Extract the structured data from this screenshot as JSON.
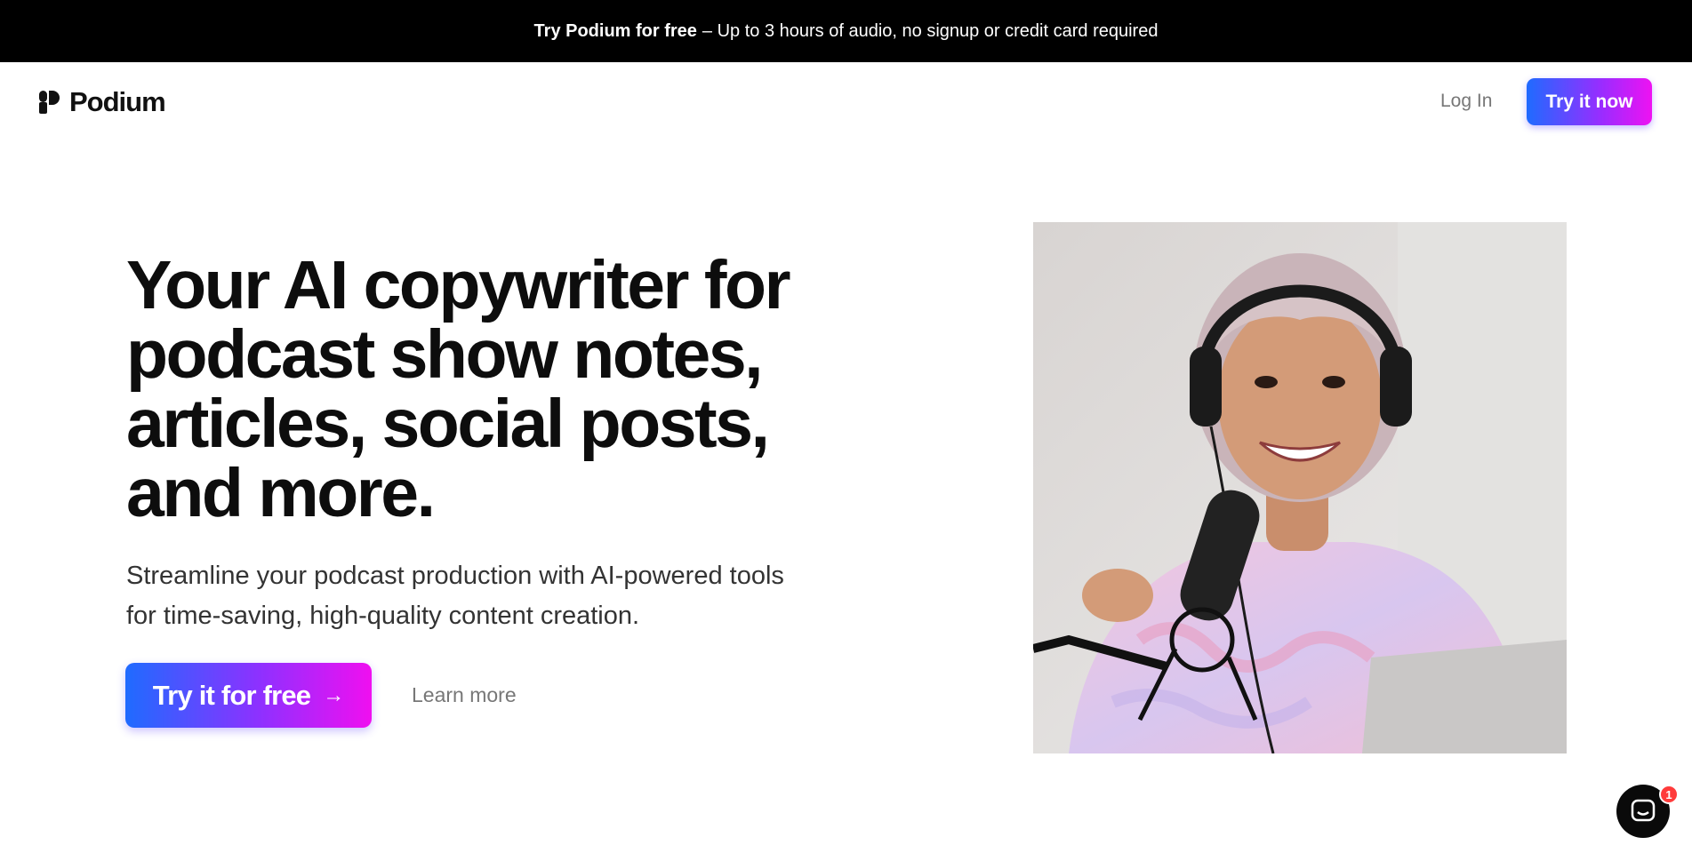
{
  "announcement": {
    "strong": "Try Podium for free",
    "rest": "– Up to 3 hours of audio, no signup or credit card required"
  },
  "nav": {
    "logo_text": "Podium",
    "login_label": "Log In",
    "cta_label": "Try it now"
  },
  "hero": {
    "headline_lines": [
      "Your AI copywriter for",
      "podcast show notes,",
      "articles, social posts,",
      "and more."
    ],
    "subcopy_lines": [
      "Streamline your podcast production with AI-powered tools",
      "for time-saving, high-quality content creation."
    ],
    "cta_label": "Try it for free",
    "learn_more_label": "Learn more"
  },
  "chat": {
    "badge_count": "1"
  },
  "colors": {
    "gradient_start": "#1f6bff",
    "gradient_end": "#f00ff0",
    "topbar_bg": "#000000"
  }
}
